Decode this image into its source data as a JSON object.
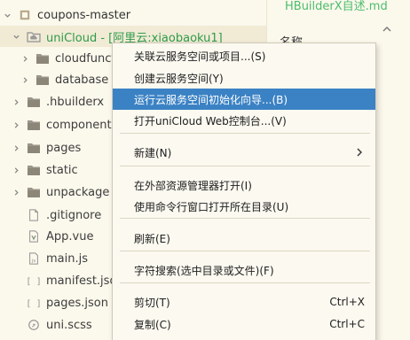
{
  "explorer": {
    "items": [
      {
        "label": "coupons-master",
        "icon": "project-box-icon",
        "expanded": true,
        "indent": 0
      },
      {
        "label": "uniCloud - [阿里云:xiaobaoku1]",
        "icon": "cloud-folder-icon",
        "expanded": true,
        "indent": 1,
        "selected": true
      },
      {
        "label": "cloudfunctions",
        "icon": "folder-icon",
        "expanded": false,
        "indent": 2
      },
      {
        "label": "database",
        "icon": "folder-icon",
        "expanded": false,
        "indent": 2
      },
      {
        "label": ".hbuilderx",
        "icon": "folder-icon",
        "expanded": false,
        "indent": 1
      },
      {
        "label": "components",
        "icon": "folder-icon",
        "expanded": false,
        "indent": 1
      },
      {
        "label": "pages",
        "icon": "folder-icon",
        "expanded": false,
        "indent": 1
      },
      {
        "label": "static",
        "icon": "folder-icon",
        "expanded": false,
        "indent": 1
      },
      {
        "label": "unpackage",
        "icon": "folder-icon",
        "expanded": false,
        "indent": 1
      },
      {
        "label": ".gitignore",
        "icon": "file-icon",
        "indent": 1
      },
      {
        "label": "App.vue",
        "icon": "vue-file-icon",
        "indent": 1
      },
      {
        "label": "main.js",
        "icon": "js-file-icon",
        "indent": 1
      },
      {
        "label": "manifest.json",
        "icon": "json-file-icon",
        "indent": 1
      },
      {
        "label": "pages.json",
        "icon": "json-file-icon",
        "indent": 1
      },
      {
        "label": "uni.scss",
        "icon": "scss-file-icon",
        "indent": 1
      }
    ]
  },
  "right_panel": {
    "tab_title": "HBuilderX自述.md",
    "section_header": "名称",
    "collapse_icon": "chevron-up-icon"
  },
  "context_menu": {
    "items": [
      {
        "type": "item",
        "label": "关联云服务空间或项目...(S)"
      },
      {
        "type": "item",
        "label": "创建云服务空间(Y)"
      },
      {
        "type": "item",
        "label": "运行云服务空间初始化向导...(B)",
        "active": true
      },
      {
        "type": "item",
        "label": "打开uniCloud Web控制台...(V)"
      },
      {
        "type": "separator"
      },
      {
        "type": "item",
        "label": "新建(N)",
        "submenu": true
      },
      {
        "type": "separator"
      },
      {
        "type": "item",
        "label": "在外部资源管理器打开(I)"
      },
      {
        "type": "item",
        "label": "使用命令行窗口打开所在目录(U)"
      },
      {
        "type": "separator"
      },
      {
        "type": "item",
        "label": "刷新(E)"
      },
      {
        "type": "separator"
      },
      {
        "type": "item",
        "label": "字符搜索(选中目录或文件)(F)"
      },
      {
        "type": "separator"
      },
      {
        "type": "item",
        "label": "剪切(T)",
        "shortcut": "Ctrl+X"
      },
      {
        "type": "item",
        "label": "复制(C)",
        "shortcut": "Ctrl+C"
      }
    ]
  },
  "colors": {
    "background": "#fbf8ec",
    "selected_row": "#f1ebd6",
    "menu_highlight": "#3b82c4",
    "accent_green": "#2f9b4a"
  }
}
